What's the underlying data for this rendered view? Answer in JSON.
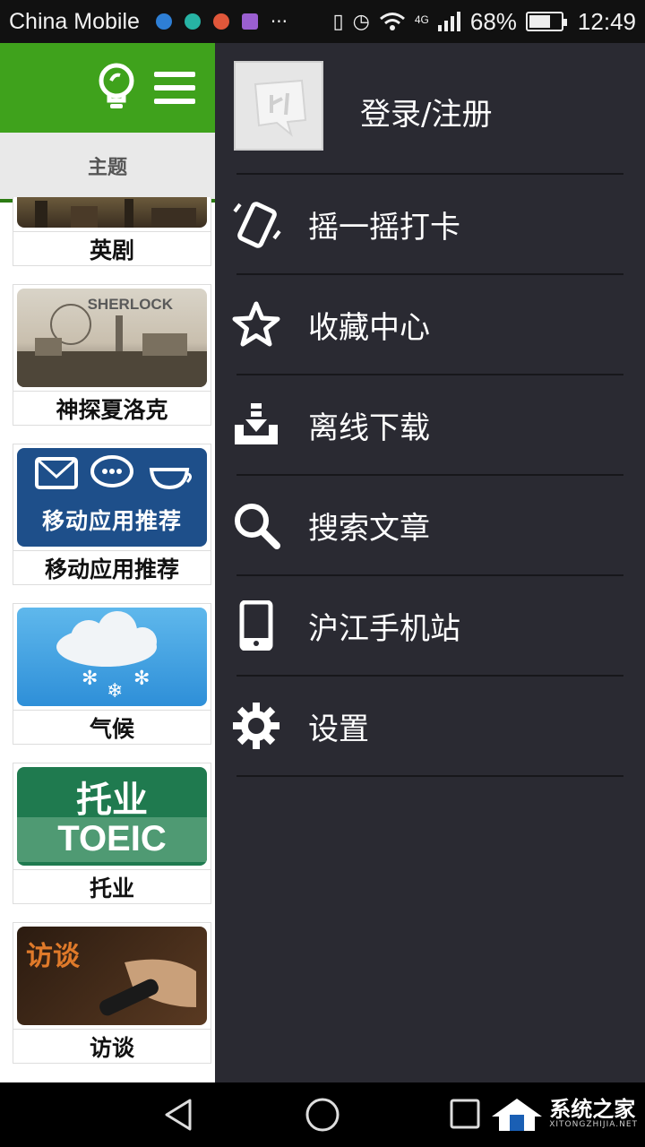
{
  "status_bar": {
    "carrier": "China Mobile",
    "network": "4G",
    "battery": "68%",
    "battery_level": 0.68,
    "time": "12:49"
  },
  "app": {
    "tab_label": "主题",
    "tiles": [
      {
        "caption": "英剧",
        "image_text": ""
      },
      {
        "caption": "神探夏洛克",
        "image_text": "SHERLOCK"
      },
      {
        "caption": "移动应用推荐",
        "image_text": "移动应用推荐"
      },
      {
        "caption": "气候",
        "image_text": ""
      },
      {
        "caption": "托业",
        "image_text": "托业",
        "image_text2": "TOEIC"
      },
      {
        "caption": "访谈",
        "image_text": "访谈"
      }
    ]
  },
  "drawer": {
    "login_label": "登录/注册",
    "items": [
      {
        "label": "摇一摇打卡",
        "icon": "shake-phone-icon"
      },
      {
        "label": "收藏中心",
        "icon": "star-icon"
      },
      {
        "label": "离线下载",
        "icon": "download-tray-icon"
      },
      {
        "label": "搜索文章",
        "icon": "search-icon"
      },
      {
        "label": "沪江手机站",
        "icon": "mobile-phone-icon"
      },
      {
        "label": "设置",
        "icon": "gear-icon"
      }
    ]
  },
  "watermark": {
    "main": "系统之家",
    "sub": "XITONGZHIJIA.NET"
  },
  "colors": {
    "brand_green": "#3fa21c",
    "drawer_bg": "#2a2a32"
  }
}
